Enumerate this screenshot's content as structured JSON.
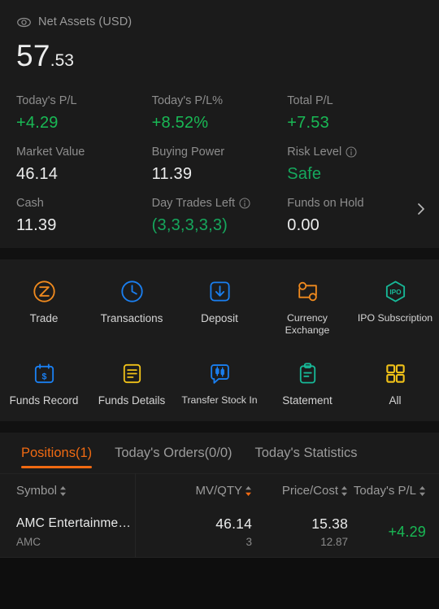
{
  "account": {
    "net_assets_label": "Net Assets (USD)",
    "eye_icon": "eye-icon",
    "net_assets_int": "57",
    "net_assets_dec": ".53",
    "chevron_icon": "chevron-right-icon",
    "stats": [
      [
        {
          "label": "Today's P/L",
          "value": "+4.29",
          "tone": "green",
          "info": false
        },
        {
          "label": "Today's P/L%",
          "value": "+8.52%",
          "tone": "green",
          "info": false
        },
        {
          "label": "Total P/L",
          "value": "+7.53",
          "tone": "green",
          "info": false
        }
      ],
      [
        {
          "label": "Market Value",
          "value": "46.14",
          "tone": "plain",
          "info": false
        },
        {
          "label": "Buying Power",
          "value": "11.39",
          "tone": "plain",
          "info": false
        },
        {
          "label": "Risk Level",
          "value": "Safe",
          "tone": "teal",
          "info": true
        }
      ],
      [
        {
          "label": "Cash",
          "value": "11.39",
          "tone": "plain",
          "info": false
        },
        {
          "label": "Day Trades Left",
          "value": "(3,3,3,3,3)",
          "tone": "teal",
          "info": true
        },
        {
          "label": "Funds on Hold",
          "value": "0.00",
          "tone": "plain",
          "info": false
        }
      ]
    ]
  },
  "actions": {
    "row1": [
      {
        "label": "Trade",
        "icon": "trade-icon",
        "color": "#f08a1e",
        "small": false
      },
      {
        "label": "Transactions",
        "icon": "clock-icon",
        "color": "#1a7ff0",
        "small": false
      },
      {
        "label": "Deposit",
        "icon": "deposit-arrow-icon",
        "color": "#1a7ff0",
        "small": false
      },
      {
        "label": "Currency\nExchange",
        "icon": "currency-exchange-icon",
        "color": "#f08a1e",
        "small": true
      },
      {
        "label": "IPO Subscription",
        "icon": "ipo-icon",
        "color": "#17b897",
        "small": true
      }
    ],
    "row2": [
      {
        "label": "Funds Record",
        "icon": "calendar-dollar-icon",
        "color": "#1a7ff0",
        "small": false
      },
      {
        "label": "Funds Details",
        "icon": "document-lines-icon",
        "color": "#f0c118",
        "small": false
      },
      {
        "label": "Transfer Stock In",
        "icon": "candlestick-box-icon",
        "color": "#1a7ff0",
        "small": true
      },
      {
        "label": "Statement",
        "icon": "clipboard-icon",
        "color": "#17b897",
        "small": false
      },
      {
        "label": "All",
        "icon": "grid-icon",
        "color": "#f0c118",
        "small": false
      }
    ]
  },
  "tabs": [
    {
      "label": "Positions(1)",
      "active": true
    },
    {
      "label": "Today's Orders(0/0)",
      "active": false
    },
    {
      "label": "Today's Statistics",
      "active": false
    }
  ],
  "table": {
    "headers": [
      {
        "label": "Symbol",
        "sort": "none"
      },
      {
        "label": "MV/QTY",
        "sort": "desc"
      },
      {
        "label": "Price/Cost",
        "sort": "none"
      },
      {
        "label": "Today's P/L",
        "sort": "none"
      }
    ],
    "rows": [
      {
        "name": "AMC Entertainme…",
        "ticker": "AMC",
        "mv": "46.14",
        "qty": "3",
        "price": "15.38",
        "cost": "12.87",
        "pl": "+4.29"
      }
    ]
  },
  "colors": {
    "accent_orange": "#f06a12",
    "positive_green": "#19b955",
    "teal": "#16a85d",
    "panel_bg": "#1b1b1b",
    "page_bg": "#111111"
  }
}
